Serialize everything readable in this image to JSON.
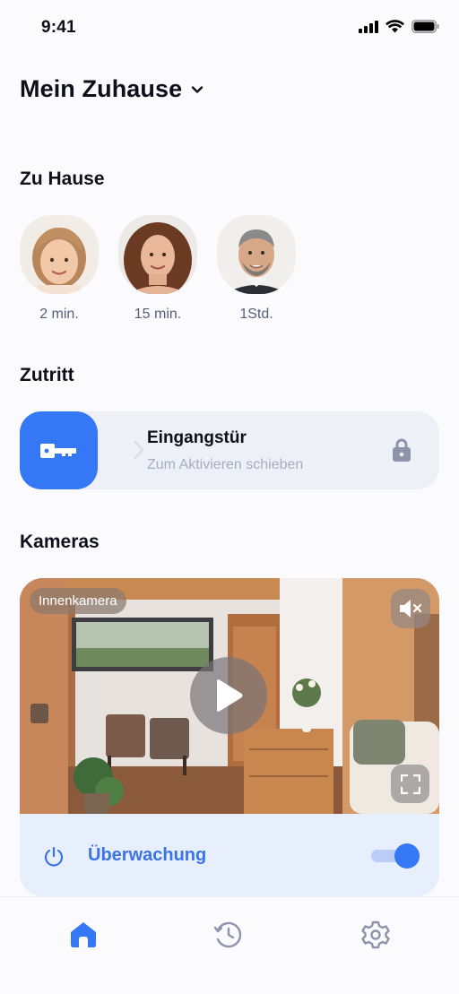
{
  "status_bar": {
    "time": "9:41"
  },
  "header": {
    "title": "Mein Zuhause"
  },
  "presence": {
    "title": "Zu Hause",
    "people": [
      {
        "time": "2 min."
      },
      {
        "time": "15 min."
      },
      {
        "time": "1Std."
      }
    ]
  },
  "access": {
    "title": "Zutritt",
    "door_name": "Eingangstür",
    "hint": "Zum Aktivieren schieben"
  },
  "cameras": {
    "title": "Kameras",
    "camera_label": "Innenkamera",
    "monitoring_label": "Überwachung",
    "monitoring_on": true
  },
  "tabs": [
    {
      "icon": "home-icon",
      "active": true
    },
    {
      "icon": "history-icon",
      "active": false
    },
    {
      "icon": "settings-icon",
      "active": false
    }
  ],
  "colors": {
    "accent": "#3478f6",
    "muted": "#a7adc0",
    "card": "#eef0f7"
  }
}
